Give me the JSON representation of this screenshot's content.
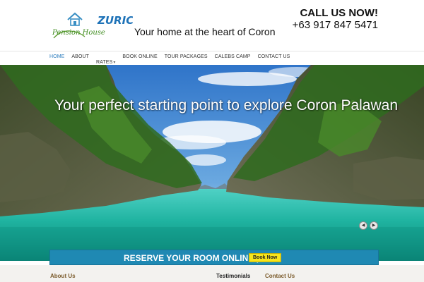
{
  "brand": {
    "logo_word_top": "ZURIC",
    "logo_word_script": "Pension House",
    "tagline": "Your home at the heart of Coron"
  },
  "contact": {
    "call_title": "CALL US NOW!",
    "phone": "+63 917 847 5471"
  },
  "nav": {
    "items": [
      {
        "label": "HOME"
      },
      {
        "label": "ABOUT"
      },
      {
        "label": "RATES"
      },
      {
        "label": "BOOK ONLINE"
      },
      {
        "label": "TOUR PACKAGES"
      },
      {
        "label": "CALEBS CAMP"
      },
      {
        "label": "CONTACT US"
      }
    ],
    "active_index": 0,
    "dropdown_caret_after": 2,
    "active_color": "#2a7bbd"
  },
  "hero": {
    "headline": "Your perfect starting point to explore Coron Palawan",
    "prev_symbol": "◀",
    "next_symbol": "▶"
  },
  "reserve": {
    "label": "RESERVE YOUR ROOM ONLINE |",
    "button_label": "Book Now",
    "bar_color": "#1f89b3",
    "button_color": "#f7e51c"
  },
  "footer": {
    "about_heading": "About Us",
    "testimonials_heading": "Testimonials",
    "contact_heading": "Contact Us"
  }
}
